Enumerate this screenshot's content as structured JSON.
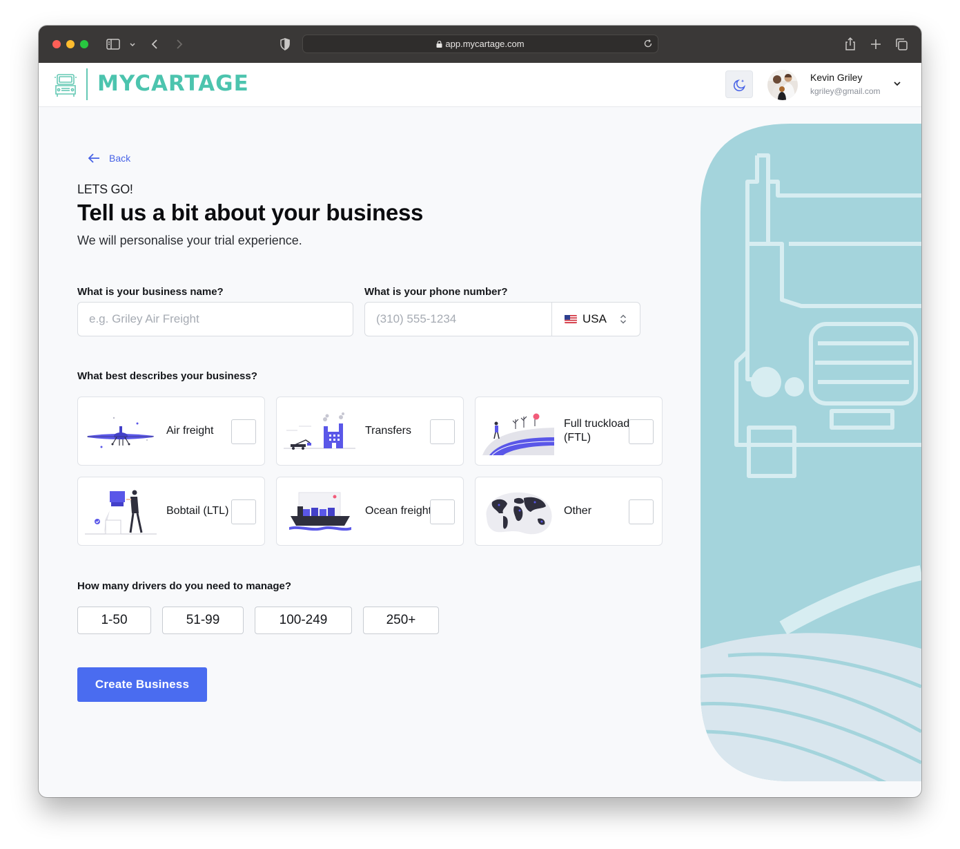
{
  "browser": {
    "url": "app.mycartage.com"
  },
  "header": {
    "logo_text": "MYCARTAGE",
    "user_name": "Kevin Griley",
    "user_email": "kgriley@gmail.com"
  },
  "main": {
    "back_label": "Back",
    "eyebrow": "LETS GO!",
    "title": "Tell us a bit about your business",
    "subtitle": "We will personalise your trial experience.",
    "business_name_label": "What is your business name?",
    "business_name_placeholder": "e.g. Griley Air Freight",
    "business_name_value": "",
    "phone_label": "What is your phone number?",
    "phone_placeholder": "(310) 555-1234",
    "phone_value": "",
    "country": "USA",
    "business_type_label": "What best describes your business?",
    "business_types": [
      {
        "label": "Air freight",
        "icon": "airplane-illustration",
        "checked": false
      },
      {
        "label": "Transfers",
        "icon": "factory-illustration",
        "checked": false
      },
      {
        "label": "Full truckload (FTL)",
        "icon": "road-illustration",
        "checked": false
      },
      {
        "label": "Bobtail (LTL)",
        "icon": "delivery-person-illustration",
        "checked": false
      },
      {
        "label": "Ocean freight",
        "icon": "cargo-ship-illustration",
        "checked": false
      },
      {
        "label": "Other",
        "icon": "world-map-illustration",
        "checked": false
      }
    ],
    "drivers_label": "How many drivers do you need to manage?",
    "driver_options": [
      "1-50",
      "51-99",
      "100-249",
      "250+"
    ],
    "cta_label": "Create Business"
  },
  "colors": {
    "accent": "#4a6cf0",
    "brand": "#4cc4ae",
    "hero_bg": "#a4d4dc"
  }
}
